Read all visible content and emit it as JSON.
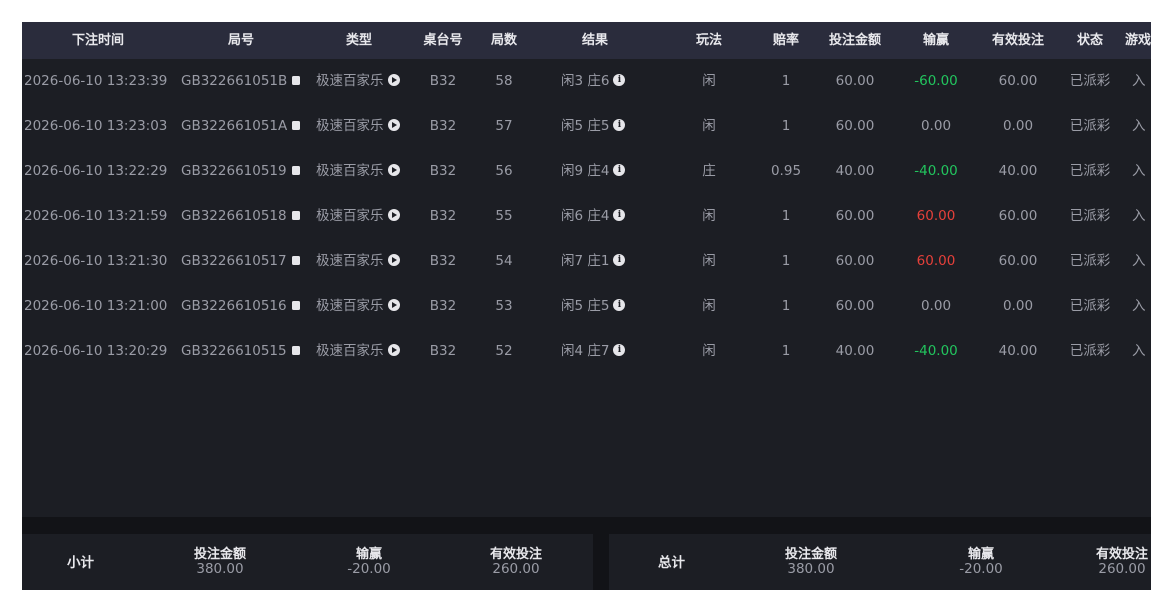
{
  "columns": [
    "下注时间",
    "局号",
    "类型",
    "桌台号",
    "局数",
    "结果",
    "玩法",
    "赔率",
    "投注金额",
    "输赢",
    "有效投注",
    "状态",
    "游戏"
  ],
  "rows": [
    {
      "time": "2026-06-10 13:23:39",
      "round_id": "GB322661051B",
      "type": "极速百家乐",
      "table": "B32",
      "round": "58",
      "result": "闲3 庄6",
      "play": "闲",
      "odds": "1",
      "bet": "60.00",
      "winloss": "-60.00",
      "winloss_sign": "neg",
      "valid_bet": "60.00",
      "status": "已派彩",
      "game": "入"
    },
    {
      "time": "2026-06-10 13:23:03",
      "round_id": "GB322661051A",
      "type": "极速百家乐",
      "table": "B32",
      "round": "57",
      "result": "闲5 庄5",
      "play": "闲",
      "odds": "1",
      "bet": "60.00",
      "winloss": "0.00",
      "winloss_sign": "zero",
      "valid_bet": "0.00",
      "status": "已派彩",
      "game": "入"
    },
    {
      "time": "2026-06-10 13:22:29",
      "round_id": "GB3226610519",
      "type": "极速百家乐",
      "table": "B32",
      "round": "56",
      "result": "闲9 庄4",
      "play": "庄",
      "odds": "0.95",
      "bet": "40.00",
      "winloss": "-40.00",
      "winloss_sign": "neg",
      "valid_bet": "40.00",
      "status": "已派彩",
      "game": "入"
    },
    {
      "time": "2026-06-10 13:21:59",
      "round_id": "GB3226610518",
      "type": "极速百家乐",
      "table": "B32",
      "round": "55",
      "result": "闲6 庄4",
      "play": "闲",
      "odds": "1",
      "bet": "60.00",
      "winloss": "60.00",
      "winloss_sign": "pos",
      "valid_bet": "60.00",
      "status": "已派彩",
      "game": "入"
    },
    {
      "time": "2026-06-10 13:21:30",
      "round_id": "GB3226610517",
      "type": "极速百家乐",
      "table": "B32",
      "round": "54",
      "result": "闲7 庄1",
      "play": "闲",
      "odds": "1",
      "bet": "60.00",
      "winloss": "60.00",
      "winloss_sign": "pos",
      "valid_bet": "60.00",
      "status": "已派彩",
      "game": "入"
    },
    {
      "time": "2026-06-10 13:21:00",
      "round_id": "GB3226610516",
      "type": "极速百家乐",
      "table": "B32",
      "round": "53",
      "result": "闲5 庄5",
      "play": "闲",
      "odds": "1",
      "bet": "60.00",
      "winloss": "0.00",
      "winloss_sign": "zero",
      "valid_bet": "0.00",
      "status": "已派彩",
      "game": "入"
    },
    {
      "time": "2026-06-10 13:20:29",
      "round_id": "GB3226610515",
      "type": "极速百家乐",
      "table": "B32",
      "round": "52",
      "result": "闲4 庄7",
      "play": "闲",
      "odds": "1",
      "bet": "40.00",
      "winloss": "-40.00",
      "winloss_sign": "neg",
      "valid_bet": "40.00",
      "status": "已派彩",
      "game": "入"
    }
  ],
  "subtotal": {
    "title": "小计",
    "bet_label": "投注金额",
    "bet": "380.00",
    "winloss_label": "输赢",
    "winloss": "-20.00",
    "valid_label": "有效投注",
    "valid": "260.00"
  },
  "total": {
    "title": "总计",
    "bet_label": "投注金额",
    "bet": "380.00",
    "winloss_label": "输赢",
    "winloss": "-20.00",
    "valid_label": "有效投注",
    "valid": "260.00"
  },
  "icons": {
    "round_id": "copy-icon",
    "type": "play-circle-icon",
    "result": "info-icon"
  },
  "colors": {
    "negative": "#22c55e",
    "positive": "#e5403a",
    "header_bg": "#2a2c3c",
    "panel_bg": "#1c1e24"
  }
}
